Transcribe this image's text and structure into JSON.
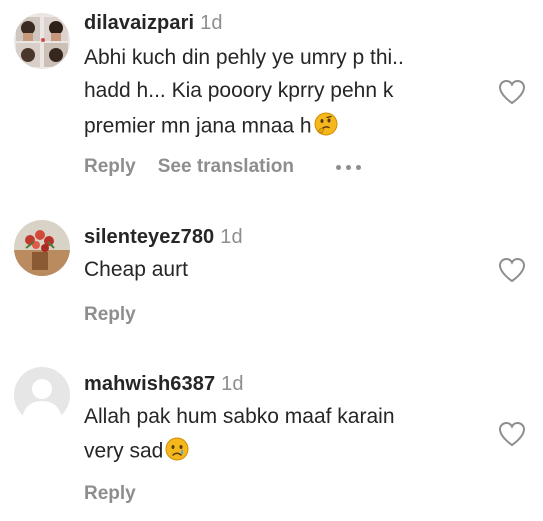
{
  "comments": [
    {
      "username": "dilavaizpari",
      "time": "1d",
      "lines": [
        "Abhi kuch din pehly ye umry p thi..",
        "hadd h... Kia pooory kprry pehn k",
        "premier mn jana mnaa h"
      ],
      "emoji": "thinking-face",
      "reply_label": "Reply",
      "translation_label": "See translation",
      "avatar": "photo-collage-avatar"
    },
    {
      "username": "silenteyez780",
      "time": "1d",
      "lines": [
        "Cheap aurt"
      ],
      "reply_label": "Reply",
      "avatar": "flowers-avatar"
    },
    {
      "username": "mahwish6387",
      "time": "1d",
      "lines": [
        "Allah pak hum sabko maaf karain",
        "very sad"
      ],
      "emoji": "crying-face",
      "reply_label": "Reply",
      "avatar": "default-avatar"
    }
  ],
  "colors": {
    "text": "#262626",
    "muted": "#8e8e8e",
    "emoji": "#f5b81c"
  }
}
